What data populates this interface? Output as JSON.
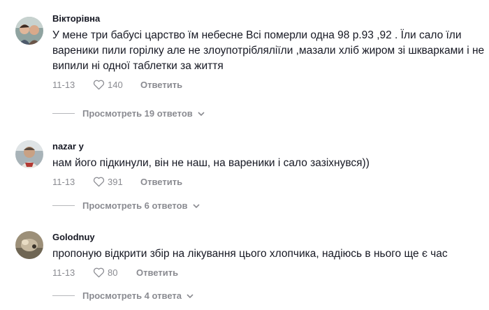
{
  "comments": [
    {
      "username": "Вікторівна",
      "text": "У мене три бабусі царство їм небесне Всі померли одна 98 р.93 ,92 . Їли сало їли вареники пили горілку але не злоупотрібляліїли ,мазали хліб жиром зі шкварками і не випили ні одної таблетки за життя",
      "date": "11-13",
      "likes": "140",
      "reply_label": "Ответить",
      "view_replies": "Просмотреть 19 ответов"
    },
    {
      "username": "nazar y",
      "text": "нам його підкинули, він не наш, на вареники і сало зазіхнувся))",
      "date": "11-13",
      "likes": "391",
      "reply_label": "Ответить",
      "view_replies": "Просмотреть 6 ответов"
    },
    {
      "username": "Golodnuy",
      "text": "пропоную відкрити збір на лікування цього хлопчика, надіюсь в нього ще є час",
      "date": "11-13",
      "likes": "80",
      "reply_label": "Ответить",
      "view_replies": "Просмотреть 4 ответа"
    }
  ],
  "icons": {
    "like": "heart-outline-icon",
    "expand": "chevron-down-icon"
  },
  "colors": {
    "text": "#161823",
    "secondary": "#8a8b91"
  }
}
